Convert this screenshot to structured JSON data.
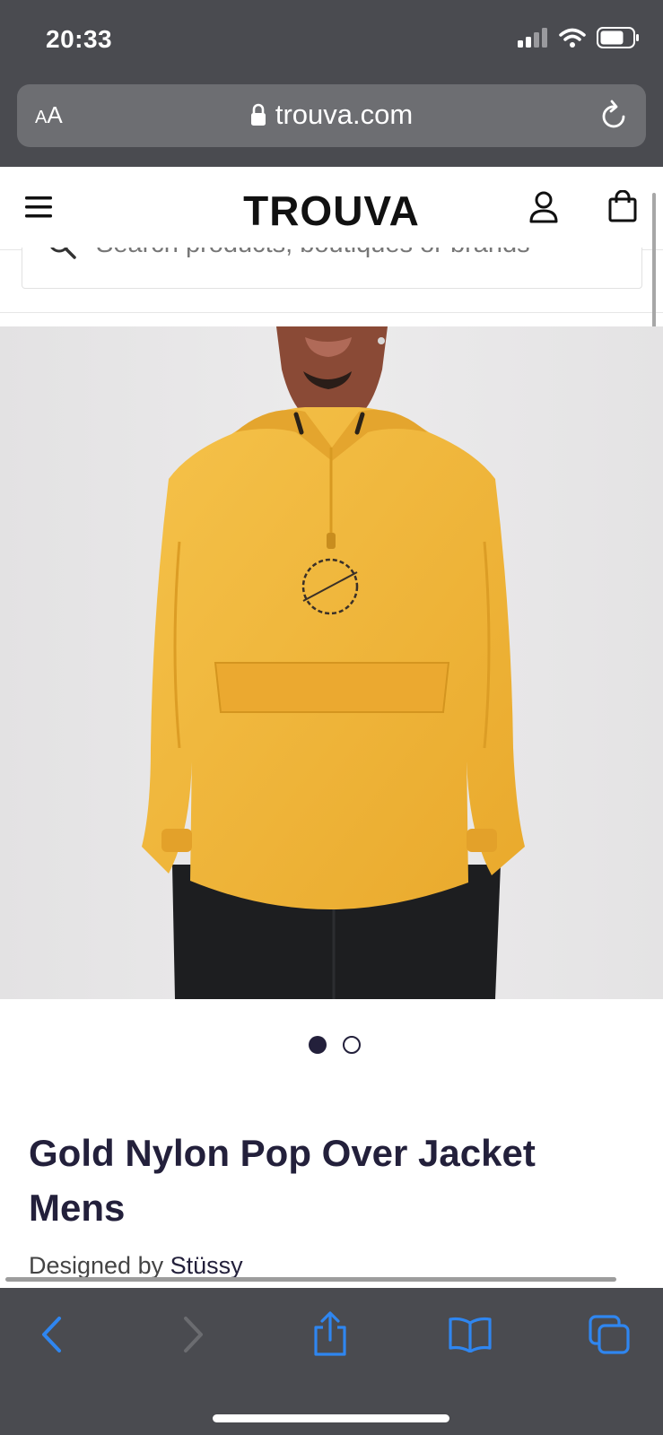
{
  "status_bar": {
    "time": "20:33",
    "icons": [
      "signal-icon",
      "wifi-icon",
      "battery-icon"
    ]
  },
  "browser": {
    "text_size_button": "AA",
    "url": "trouva.com",
    "icons": [
      "lock-icon",
      "reload-icon"
    ]
  },
  "header": {
    "logo": "TROUVA",
    "icons": [
      "menu-icon",
      "account-icon",
      "shopping-bag-icon"
    ]
  },
  "search": {
    "placeholder": "Search products, boutiques or brands",
    "icon": "search-icon"
  },
  "product": {
    "image_alt": "Model wearing yellow Stüssy International pop over jacket",
    "print_text": "STUSSY INTERNATIONAL",
    "gallery": {
      "total": 2,
      "active": 1
    },
    "title": "Gold Nylon Pop Over Jacket Mens",
    "designed_by_label": "Designed by",
    "brand": "Stüssy"
  },
  "toolbar": {
    "icons": [
      "back-icon",
      "forward-icon",
      "share-icon",
      "bookmarks-icon",
      "tabs-icon"
    ],
    "forward_enabled": false
  },
  "colors": {
    "browser_chrome": "#4a4b50",
    "url_field": "#6d6e72",
    "toolbar_icon": "#2f86f0",
    "title_text": "#23203b",
    "jacket": "#f2b637"
  }
}
